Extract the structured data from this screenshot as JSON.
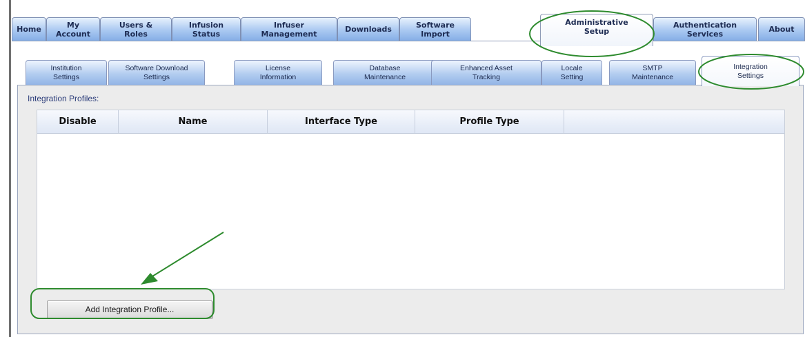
{
  "main_tabs": [
    {
      "label": "Home",
      "active": false
    },
    {
      "label": "My\nAccount",
      "active": false
    },
    {
      "label": "Users &\nRoles",
      "active": false
    },
    {
      "label": "Infusion\nStatus",
      "active": false
    },
    {
      "label": "Infuser\nManagement",
      "active": false
    },
    {
      "label": "Downloads",
      "active": false
    },
    {
      "label": "Software\nImport",
      "active": false
    },
    {
      "label": "Administrative\nSetup",
      "active": true
    },
    {
      "label": "Authentication\nServices",
      "active": false
    },
    {
      "label": "About",
      "active": false
    }
  ],
  "sub_tabs": [
    {
      "label": "Institution\nSettings",
      "active": false
    },
    {
      "label": "Software Download\nSettings",
      "active": false
    },
    {
      "label": "License\nInformation",
      "active": false
    },
    {
      "label": "Database\nMaintenance",
      "active": false
    },
    {
      "label": "Enhanced Asset\nTracking",
      "active": false
    },
    {
      "label": "Locale\nSetting",
      "active": false
    },
    {
      "label": "SMTP\nMaintenance",
      "active": false
    },
    {
      "label": "Integration\nSettings",
      "active": true
    }
  ],
  "integration": {
    "section_label": "Integration Profiles:",
    "columns": [
      "Disable",
      "Name",
      "Interface Type",
      "Profile Type",
      ""
    ],
    "rows": [],
    "add_button_label": "Add Integration Profile..."
  },
  "colors": {
    "tab_gradient": "#a9c8f1",
    "annotation_green": "#2e8b2e",
    "section_label": "#2c3d7a"
  }
}
